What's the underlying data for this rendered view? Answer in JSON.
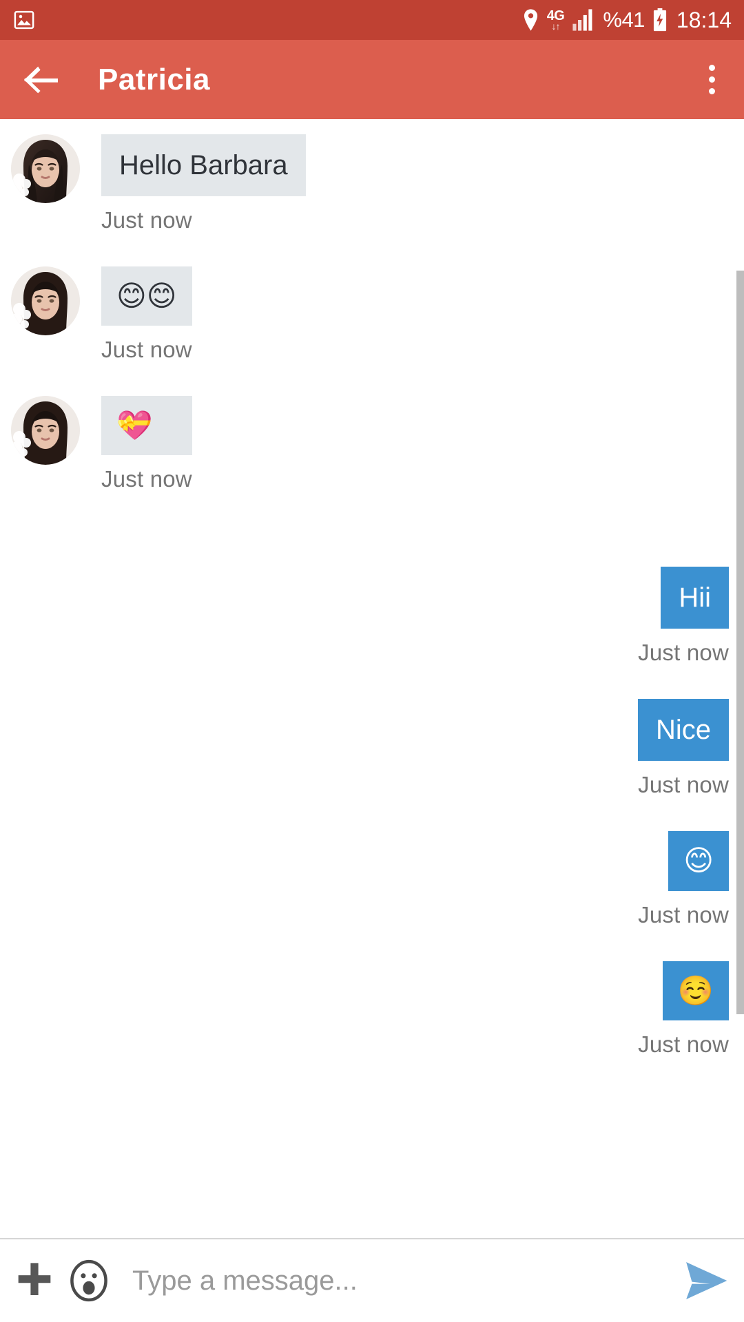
{
  "status_bar": {
    "left_icon": "photo-icon",
    "icons": [
      "location-pin-icon",
      "signal-icon",
      "battery-charging-icon"
    ],
    "network_label": "4G",
    "network_arrows": "↓↑",
    "battery_percent": "%41",
    "clock": "18:14",
    "background_color": "#BF4133"
  },
  "app_bar": {
    "back_icon": "back-arrow-icon",
    "title": "Patricia",
    "overflow_icon": "more-vertical-icon",
    "background_color": "#DC5E4E"
  },
  "theme": {
    "incoming_bubble_color": "#E3E7EA",
    "outgoing_bubble_color": "#3B91D1",
    "incoming_text_color": "#30343A",
    "outgoing_text_color": "#FFFFFF",
    "timestamp_color": "#757575",
    "send_icon_color": "#6FA8D6"
  },
  "messages": [
    {
      "side": "in",
      "type": "text",
      "text": "Hello Barbara",
      "timestamp": "Just now",
      "avatar": "contact-avatar"
    },
    {
      "side": "in",
      "type": "emoji",
      "text": "😊😊",
      "timestamp": "Just now",
      "avatar": "contact-avatar"
    },
    {
      "side": "in",
      "type": "emoji",
      "text": "💝",
      "timestamp": "Just now",
      "avatar": "contact-avatar"
    },
    {
      "side": "out",
      "type": "text",
      "text": "Hii",
      "timestamp": "Just now"
    },
    {
      "side": "out",
      "type": "text",
      "text": "Nice",
      "timestamp": "Just now"
    },
    {
      "side": "out",
      "type": "emoji",
      "text": "😊",
      "timestamp": "Just now"
    },
    {
      "side": "out",
      "type": "emoji",
      "text": "☺️",
      "timestamp": "Just now"
    }
  ],
  "input_bar": {
    "attach_icon": "plus-icon",
    "emoji_icon": "emoji-face-icon",
    "placeholder": "Type a message...",
    "value": "",
    "send_icon": "send-arrow-icon"
  }
}
